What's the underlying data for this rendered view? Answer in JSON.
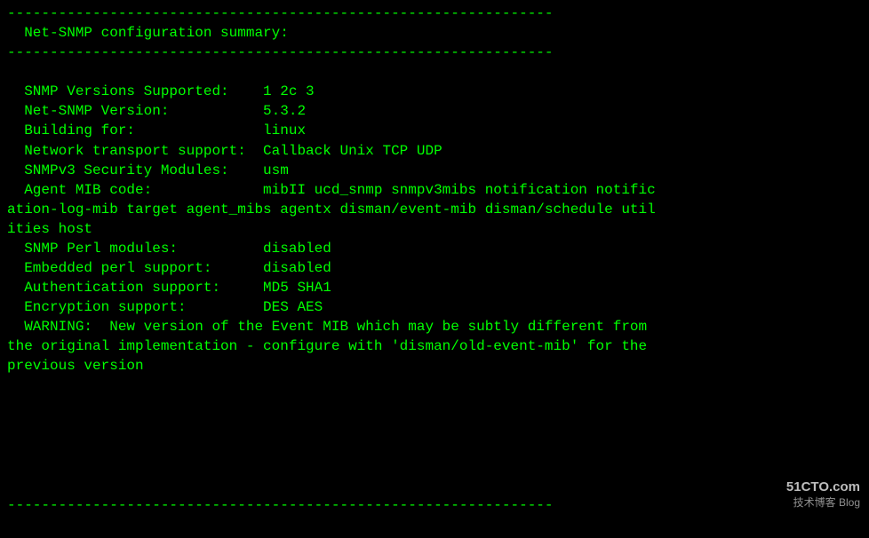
{
  "terminal": {
    "title": "Net-SNMP configuration summary",
    "separator_top": "----------------------------------------------------------------",
    "separator_bottom": "----------------------------------------------------------------",
    "heading": "  Net-SNMP configuration summary:",
    "fields": [
      {
        "label": "  SNMP Versions Supported:",
        "value": "   1 2c 3"
      },
      {
        "label": "  Net-SNMP Version:",
        "value": "            5.3.2"
      },
      {
        "label": "  Building for:",
        "value": "               linux"
      },
      {
        "label": "  Network transport support:",
        "value": " Callback Unix TCP UDP"
      },
      {
        "label": "  SNMPv3 Security Modules:",
        "value": "   usm"
      },
      {
        "label": "  Agent MIB code:",
        "value": "           mibII ucd_snmp snmpv3mibs notification notific"
      },
      {
        "label_cont": "ation-log-mib target agent_mibs agentx disman/event-mib disman/schedule util"
      },
      {
        "label_cont2": "ities host"
      },
      {
        "label": "  SNMP Perl modules:",
        "value": "         disabled"
      },
      {
        "label": "  Embedded perl support:",
        "value": "      disabled"
      },
      {
        "label": "  Authentication support:",
        "value": "     MD5 SHA1"
      },
      {
        "label": "  Encryption support:",
        "value": "         DES AES"
      },
      {
        "label": "  WARNING:",
        "value": "  New version of the Event MIB which may be subtly different from"
      },
      {
        "label_cont": "the original implementation - configure with 'disman/old-event-mib' for the"
      },
      {
        "label_cont2": "previous version"
      }
    ],
    "watermark_main": "51CTO.com",
    "watermark_sub": "技术博客  Blog"
  }
}
